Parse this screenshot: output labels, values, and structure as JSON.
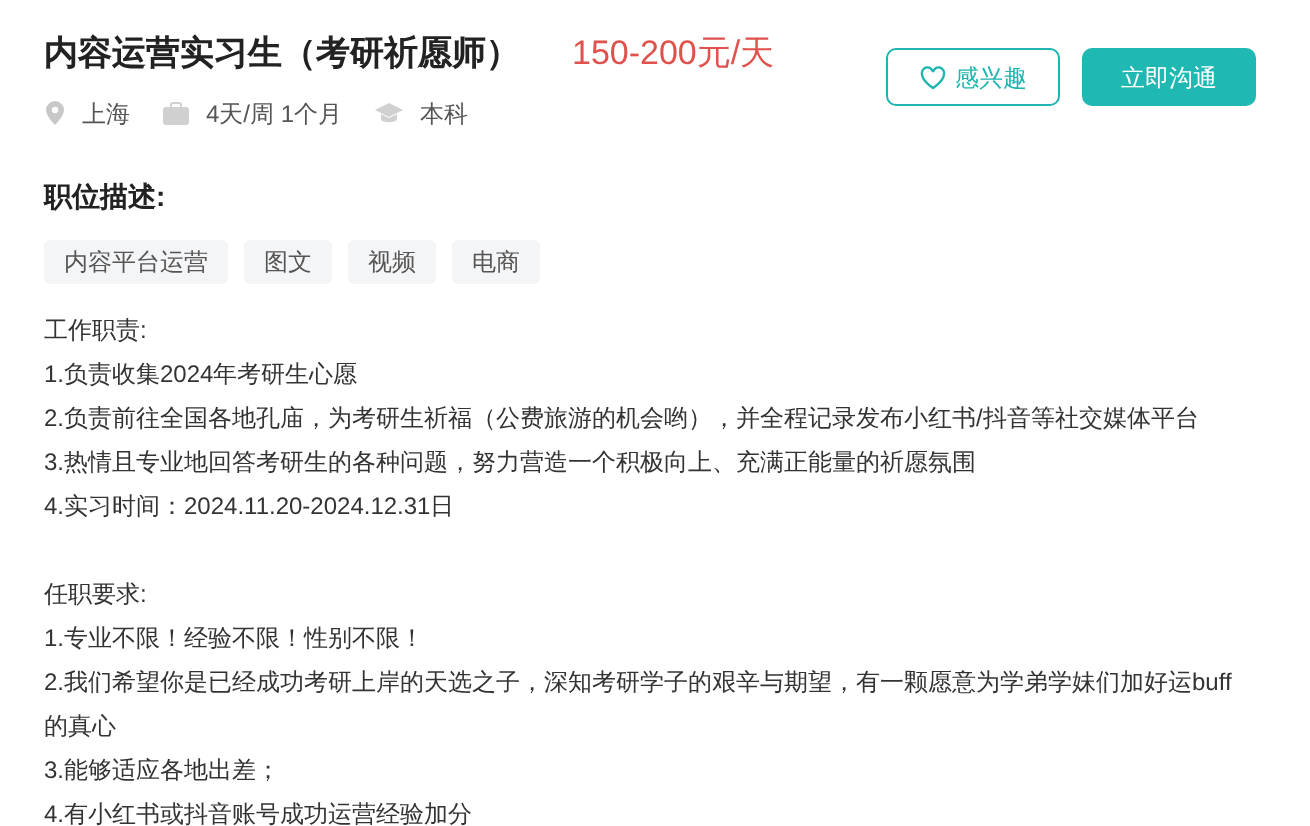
{
  "job": {
    "title": "内容运营实习生（考研祈愿师）",
    "salary": "150-200元/天",
    "meta": [
      {
        "kind": "location",
        "text": "上海"
      },
      {
        "kind": "schedule",
        "text": "4天/周 1个月"
      },
      {
        "kind": "education",
        "text": "本科"
      }
    ]
  },
  "actions": [
    {
      "kind": "outline",
      "label": "感兴趣"
    },
    {
      "kind": "primary",
      "label": "立即沟通"
    }
  ],
  "description": {
    "heading": "职位描述:",
    "tags": [
      "内容平台运营",
      "图文",
      "视频",
      "电商"
    ],
    "sections": [
      {
        "heading": "工作职责:",
        "items": [
          "1.负责收集2024年考研生心愿",
          "2.负责前往全国各地孔庙，为考研生祈福（公费旅游的机会哟），并全程记录发布小红书/抖音等社交媒体平台",
          "3.热情且专业地回答考研生的各种问题，努力营造一个积极向上、充满正能量的祈愿氛围",
          "4.实习时间：2024.11.20-2024.12.31日"
        ]
      },
      {
        "heading": "任职要求:",
        "items": [
          "1.专业不限！经验不限！性别不限！",
          "2.我们希望你是已经成功考研上岸的天选之子，深知考研学子的艰辛与期望，有一颗愿意为学弟学妹们加好运buff的真心",
          "3.能够适应各地出差；",
          "4.有小红书或抖音账号成功运营经验加分"
        ]
      }
    ]
  }
}
